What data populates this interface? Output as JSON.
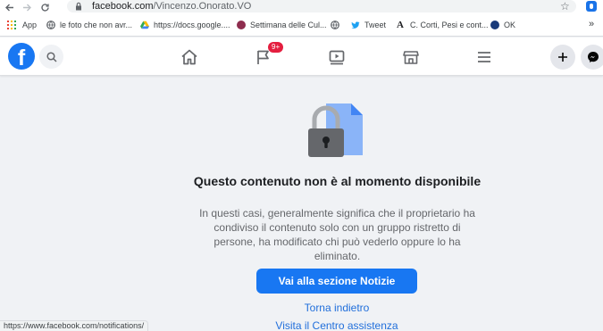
{
  "browser": {
    "url_domain": "facebook.com",
    "url_path": "/Vincenzo.Onorato.VO",
    "bookmarks": [
      {
        "label": "App",
        "icon": "apps-grid-icon"
      },
      {
        "label": "le foto che non avr...",
        "icon": "globe-icon"
      },
      {
        "label": "https://docs.google....",
        "icon": "google-drive-icon"
      },
      {
        "label": "Settimana delle Cul...",
        "icon": "site-favicon-icon"
      },
      {
        "label": "",
        "icon": "globe-icon"
      },
      {
        "label": "Tweet",
        "icon": "twitter-icon"
      },
      {
        "label": "C. Corti, Pesi e cont...",
        "icon": "serif-a-icon"
      },
      {
        "label": "OK",
        "icon": "site-favicon-icon"
      }
    ],
    "overflow": "»",
    "status_url": "https://www.facebook.com/notifications/"
  },
  "header": {
    "logo": "f",
    "notification_badge": "9+"
  },
  "content": {
    "title": "Questo contenuto non è al momento disponibile",
    "description": "In questi casi, generalmente significa che il proprietario ha condiviso il contenuto solo con un gruppo ristretto di persone, ha modificato chi può vederlo oppure lo ha eliminato.",
    "primary_button": "Vai alla sezione Notizie",
    "back_link": "Torna indietro",
    "help_link": "Visita il Centro assistenza"
  },
  "colors": {
    "brand": "#1877f2",
    "badge": "#e41e3f",
    "page_bg": "#f0f2f5"
  }
}
